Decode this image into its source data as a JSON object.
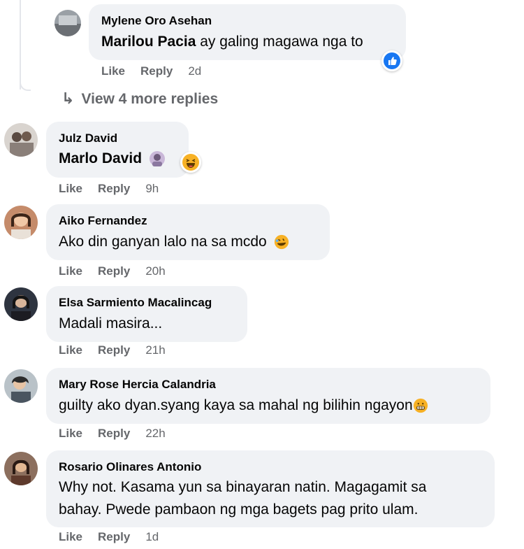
{
  "reply": {
    "author": "Mylene Oro Asehan",
    "mention": "Marilou Pacia",
    "text": " ay galing magawa nga to",
    "like": "Like",
    "reply": "Reply",
    "time": "2d",
    "reaction_icon": "like-reaction-icon"
  },
  "view_more": {
    "icon": "reply-arrow-icon",
    "label": "View 4 more replies"
  },
  "comments": [
    {
      "author": "Julz David",
      "text": "Marlo David",
      "like": "Like",
      "reply": "Reply",
      "time": "9h",
      "reaction_icon": "haha-reaction-icon"
    },
    {
      "author": "Aiko Fernandez",
      "text": "Ako din ganyan lalo na sa mcdo",
      "like": "Like",
      "reply": "Reply",
      "time": "20h"
    },
    {
      "author": "Elsa Sarmiento Macalincag",
      "text": "Madali masira...",
      "like": "Like",
      "reply": "Reply",
      "time": "21h"
    },
    {
      "author": "Mary Rose Hercia Calandria",
      "text": "guilty ako dyan.syang kaya sa mahal ng bilihin ngayon",
      "like": "Like",
      "reply": "Reply",
      "time": "22h"
    },
    {
      "author": "Rosario Olinares Antonio",
      "text_line1": "Why not. Kasama yun sa binayaran natin. Magagamit sa",
      "text_line2": "bahay. Pwede pambaon ng mga bagets pag prito ulam.",
      "like": "Like",
      "reply": "Reply",
      "time": "1d"
    }
  ],
  "colors": {
    "bubble": "#f0f2f5",
    "meta": "#65676b",
    "like_blue": "#1877f2",
    "haha_yellow": "#f7b125"
  }
}
